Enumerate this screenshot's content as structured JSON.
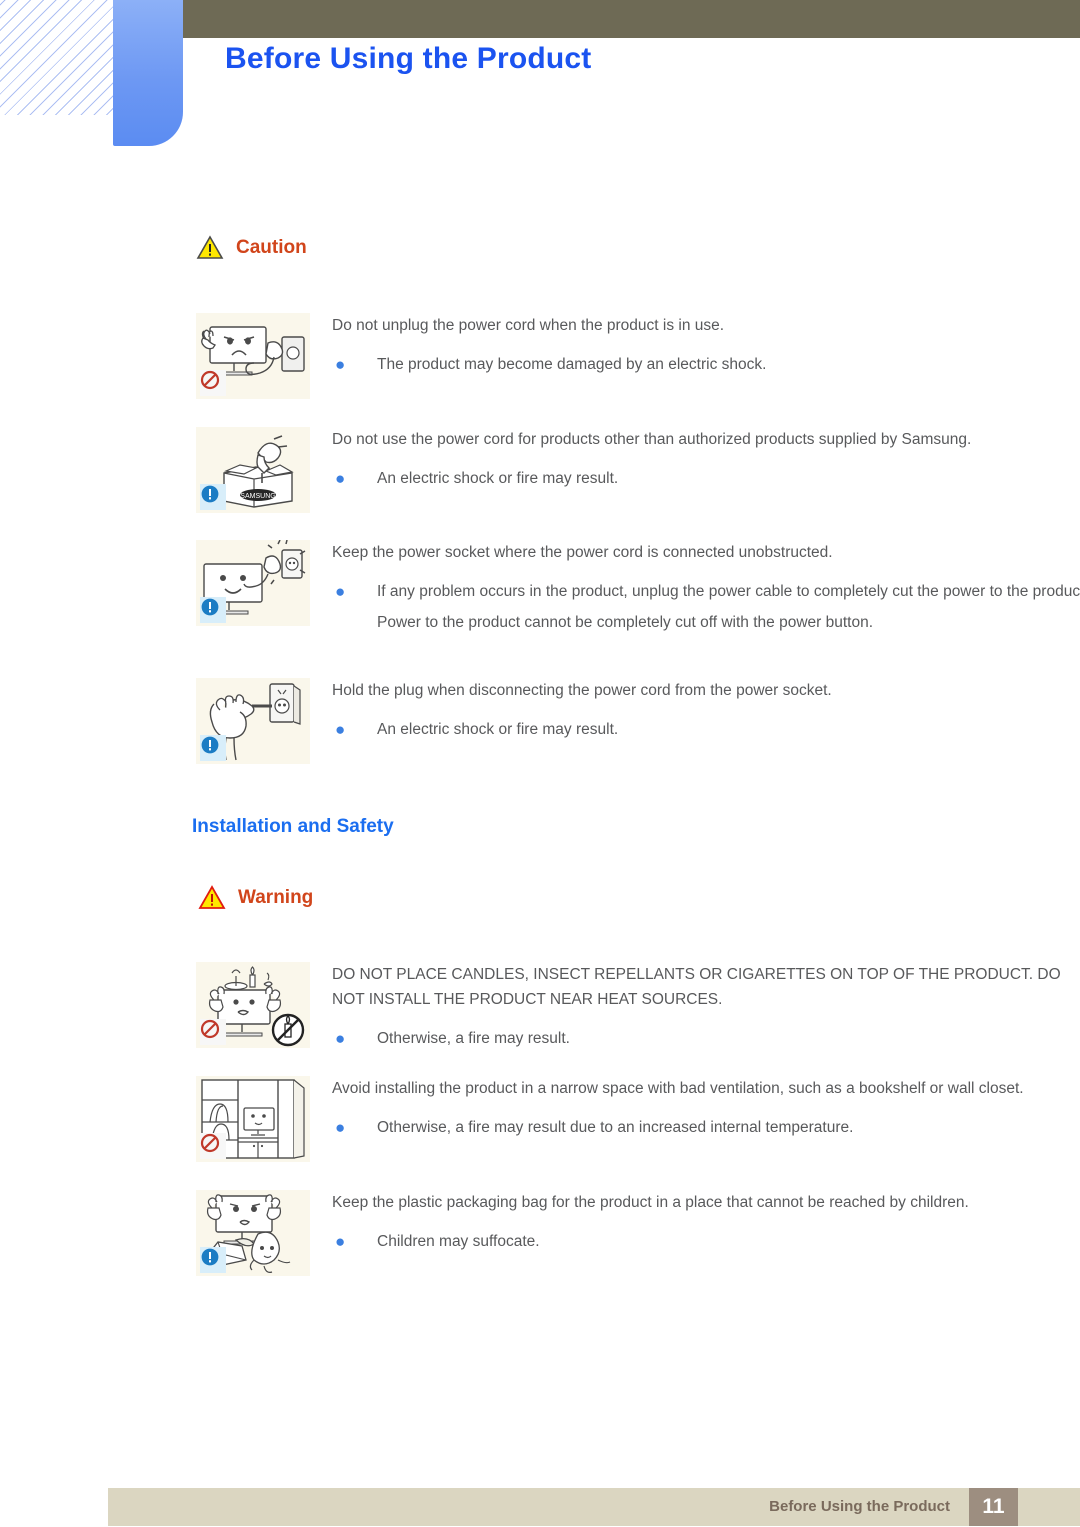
{
  "header": {
    "title": "Before Using the Product",
    "title_color": "#1b53f0",
    "bar_color": "#6e6a55",
    "tab_color": "#6d98f3"
  },
  "caution_block": {
    "icon": "warning-triangle-icon",
    "label": "Caution",
    "label_color": "#d1451b",
    "items": [
      {
        "illustration": "monitor-unplug-cord-icon",
        "badge": "prohibition-icon",
        "main": "Do not unplug the power cord when the product is in use.",
        "bullets": [
          "The product may become damaged by an electric shock."
        ],
        "extra": []
      },
      {
        "illustration": "power-plug-in-samsung-box-icon",
        "badge": "info-exclamation-icon",
        "main": "Do not use the power cord for products other than authorized products supplied by Samsung.",
        "bullets": [
          "An electric shock or fire may result."
        ],
        "extra": []
      },
      {
        "illustration": "monitor-socket-unobstructed-icon",
        "badge": "info-exclamation-icon",
        "main": "Keep the power socket where the power cord is connected unobstructed.",
        "bullets": [
          "If any problem occurs in the product, unplug the power cable to completely cut the power to the product."
        ],
        "extra": [
          "Power to the product cannot be completely cut off with the power button."
        ]
      },
      {
        "illustration": "hand-holding-plug-icon",
        "badge": "info-exclamation-icon",
        "main": "Hold the plug when disconnecting the power cord from the power socket.",
        "bullets": [
          "An electric shock or fire may result."
        ],
        "extra": []
      }
    ]
  },
  "installation_section": {
    "heading": "Installation and Safety",
    "heading_color": "#1b6ef0",
    "warning": {
      "icon": "warning-triangle-icon",
      "label": "Warning",
      "label_color": "#d1451b"
    },
    "items": [
      {
        "illustration": "monitor-candles-on-top-icon",
        "badge": "prohibition-icon",
        "badge2": "no-candle-circle-icon",
        "main": "DO NOT PLACE CANDLES, INSECT REPELLANTS OR CIGARETTES ON TOP OF THE PRODUCT. DO NOT INSTALL THE PRODUCT NEAR HEAT SOURCES.",
        "bullets": [
          "Otherwise, a fire may result."
        ],
        "extra": []
      },
      {
        "illustration": "monitor-in-bookshelf-icon",
        "badge": "prohibition-icon",
        "main": "Avoid installing the product in a narrow space with bad ventilation, such as a bookshelf or wall closet.",
        "bullets": [
          "Otherwise, a fire may result due to an increased internal temperature."
        ],
        "extra": []
      },
      {
        "illustration": "child-with-plastic-bag-icon",
        "badge": "info-exclamation-icon",
        "main": "Keep the plastic packaging bag for the product in a place that cannot be reached by children.",
        "bullets": [
          "Children may suffocate."
        ],
        "extra": []
      }
    ]
  },
  "footer": {
    "text": "Before Using the Product",
    "page_number": "11",
    "bar_color": "#dbd6c1",
    "page_box_color": "#9d8e80"
  }
}
